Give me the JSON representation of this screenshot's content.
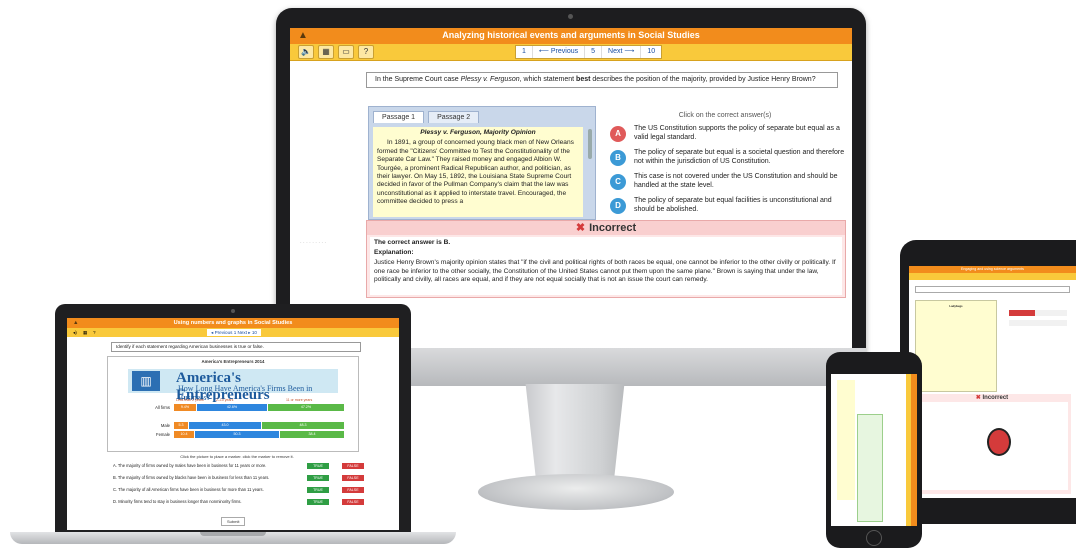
{
  "monitor": {
    "logo": "▲",
    "title": "Analyzing historical events and arguments in Social Studies",
    "tools": [
      "🔈",
      "▦",
      "▭",
      "?"
    ],
    "nav": {
      "first": "1",
      "prev": "⟵ Previous",
      "current": "5",
      "next": "Next ⟶",
      "last": "10"
    },
    "question_pre": "In the Supreme Court case ",
    "question_case": "Plessy v. Ferguson",
    "question_mid": ", which statement ",
    "question_bold": "best",
    "question_post": " describes the position of the majority, provided by Justice Henry Brown?",
    "tabs": [
      "Passage 1",
      "Passage 2"
    ],
    "passage_title": "Plessy v. Ferguson, Majority Opinion",
    "passage_text": "In 1891, a group of concerned young black men of New Orleans formed the \"Citizens' Committee to Test the Constitutionality of the Separate Car Law.\" They raised money and engaged Albion W. Tourgée, a prominent Radical Republican author, and politician, as their lawyer. On May 15, 1892, the Louisiana State Supreme Court decided in favor of the Pullman Company's claim that the law was unconstitutional as it applied to interstate travel. Encouraged, the committee decided to press a",
    "click_hint": "Click on the correct answer(s)",
    "answers": [
      {
        "letter": "A",
        "text": "The US Constitution supports the policy of separate but equal as a valid legal standard.",
        "color": "#e05a5a"
      },
      {
        "letter": "B",
        "text": "The policy of separate but equal is a societal question and therefore not within the jurisdiction of US Constitution.",
        "color": "#3c9ad6"
      },
      {
        "letter": "C",
        "text": "This case is not covered under the US Constitution and should be handled at the state level.",
        "color": "#3c9ad6"
      },
      {
        "letter": "D",
        "text": "The policy of separate but equal facilities is unconstitutional and should be abolished.",
        "color": "#3c9ad6"
      }
    ],
    "feedback": {
      "icon": "✖",
      "heading": "Incorrect",
      "correct": "The correct answer is B.",
      "explanation_label": "Explanation:",
      "explanation": "Justice Henry Brown's majority opinion states that \"if the civil and political rights of both races be equal, one cannot be inferior to the other civilly or politically. If one race be inferior to the other socially, the Constitution of the United States cannot put them upon the same plane.\" Brown is saying that under the law, politically and civilly, all races are equal, and if they are not equal socially that is not an issue the court can remedy."
    }
  },
  "laptop": {
    "title": "Using numbers and graphs in Social Studies",
    "nav": "◂ Previous   1   Next ▸   10",
    "question": "Identify if each statement regarding American businesses is true or false.",
    "chart_title": "America's Entrepreneurs 2014",
    "banner_big": "America's Entrepreneurs",
    "banner_sub": "How Long Have America's Firms Been in Business?",
    "rows": [
      {
        "label": "All firms",
        "values": [
          "9.4%",
          "42.6%",
          "47.2%"
        ]
      },
      {
        "label": "Male",
        "values": [
          "5.3",
          "43.0",
          "48.3"
        ]
      },
      {
        "label": "Female",
        "values": [
          "10.4",
          "50.3",
          "38.4"
        ]
      }
    ],
    "hint": "Click the picture to place a marker. click the marker to remove it.",
    "statements": [
      "A. The majority of firms owned by males have been in business for 11 years or more.",
      "B. The majority of firms owned by blacks have been in business for less than 11 years.",
      "C. The majority of all American firms have been in business for more than 11 years.",
      "D. Minority firms tend to stay in business longer than nonminority firms."
    ],
    "true_label": "TRUE",
    "false_label": "FALSE",
    "submit": "Submit"
  },
  "tablet": {
    "title": "Engaging and using science arguments",
    "incorrect": "Incorrect",
    "passage_title": "Ladybugs"
  }
}
